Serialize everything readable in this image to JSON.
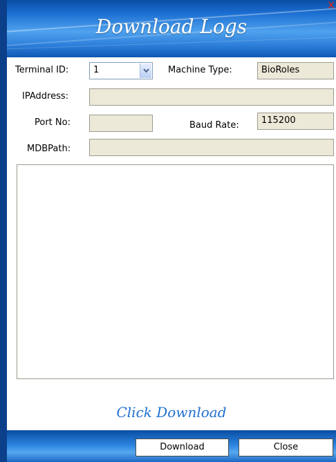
{
  "window": {
    "title": "Download Logs",
    "close_glyph": "x"
  },
  "form": {
    "terminal_id_label": "Terminal ID:",
    "terminal_id_value": "1",
    "machine_type_label": "Machine Type:",
    "machine_type_value": "BioRoles",
    "ip_address_label": "IPAddress:",
    "ip_address_value": "",
    "port_no_label": "Port No:",
    "port_no_value": "",
    "baud_rate_label": "Baud Rate:",
    "baud_rate_value": "115200",
    "mdb_path_label": "MDBPath:",
    "mdb_path_value": ""
  },
  "log": {
    "content": ""
  },
  "hint_text": "Click Download",
  "buttons": {
    "download_label": "Download",
    "close_label": "Close"
  },
  "colors": {
    "titlebar_blue": "#1a6dd0",
    "field_bg": "#ece9d8",
    "hint_blue": "#1f6fcf",
    "close_red": "#d9271c"
  }
}
